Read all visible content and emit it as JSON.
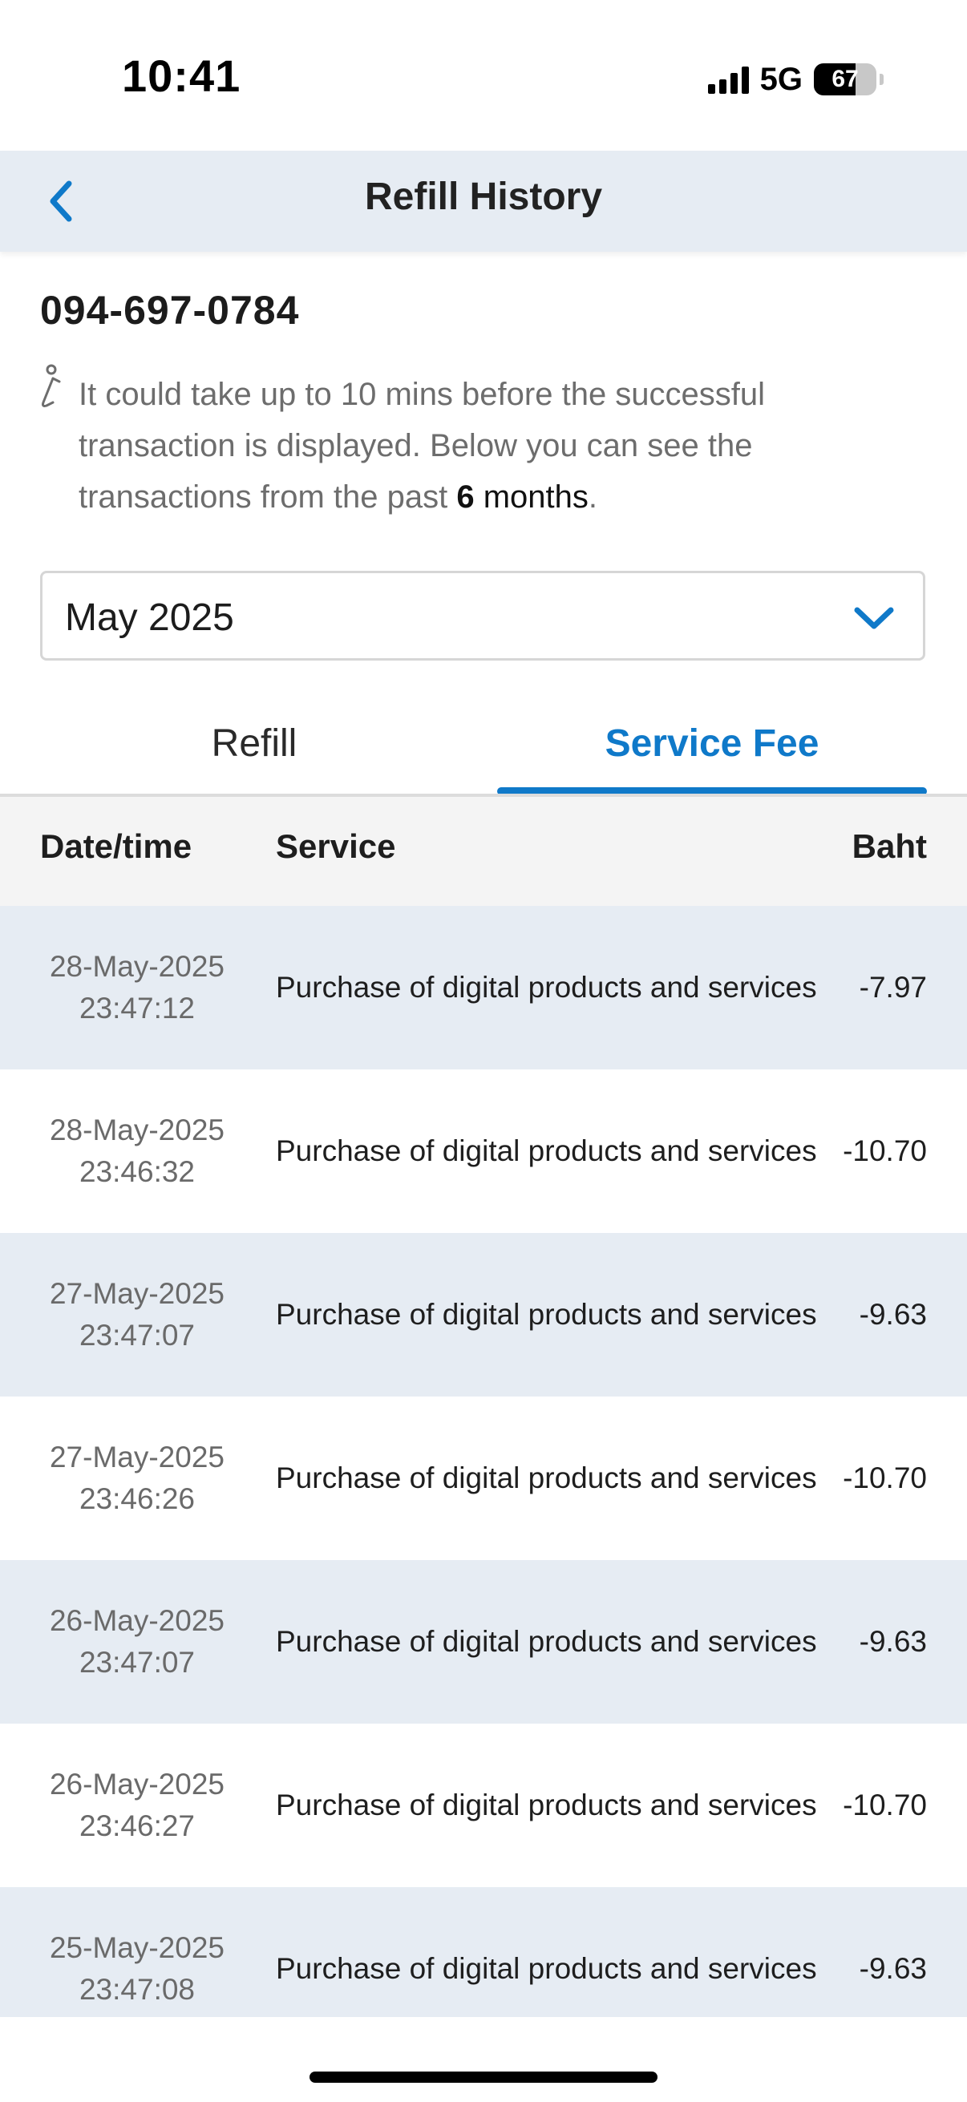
{
  "status_bar": {
    "time": "10:41",
    "network": "5G",
    "battery": "67",
    "battery_level_percent": 67,
    "signal_bars_active": 4
  },
  "header": {
    "title": "Refill History",
    "back_icon": "chevron-left-icon"
  },
  "account": {
    "phone_number": "094-697-0784"
  },
  "info": {
    "icon": "info-icon",
    "text_before": "It could take up to 10 mins before the successful transaction is displayed. Below you can see the transactions from the past ",
    "months_count": "6",
    "text_after": " months",
    "text_end": "."
  },
  "month_select": {
    "value": "May 2025",
    "icon": "chevron-down-icon"
  },
  "tabs": [
    {
      "label": "Refill",
      "active": false
    },
    {
      "label": "Service Fee",
      "active": true
    }
  ],
  "table": {
    "headers": {
      "date": "Date/time",
      "service": "Service",
      "amount": "Baht"
    },
    "rows": [
      {
        "date": "28-May-2025",
        "time": "23:47:12",
        "service": "Purchase of digital products and services",
        "amount": "-7.97"
      },
      {
        "date": "28-May-2025",
        "time": "23:46:32",
        "service": "Purchase of digital products and services",
        "amount": "-10.70"
      },
      {
        "date": "27-May-2025",
        "time": "23:47:07",
        "service": "Purchase of digital products and services",
        "amount": "-9.63"
      },
      {
        "date": "27-May-2025",
        "time": "23:46:26",
        "service": "Purchase of digital products and services",
        "amount": "-10.70"
      },
      {
        "date": "26-May-2025",
        "time": "23:47:07",
        "service": "Purchase of digital products and services",
        "amount": "-9.63"
      },
      {
        "date": "26-May-2025",
        "time": "23:46:27",
        "service": "Purchase of digital products and services",
        "amount": "-10.70"
      },
      {
        "date": "25-May-2025",
        "time": "23:47:08",
        "service": "Purchase of digital products and services",
        "amount": "-9.63"
      }
    ]
  },
  "colors": {
    "accent": "#0f79c9",
    "header_bg": "#e6ecf3",
    "row_shaded_bg": "#e6ecf3",
    "table_header_bg": "#f4f4f4"
  }
}
